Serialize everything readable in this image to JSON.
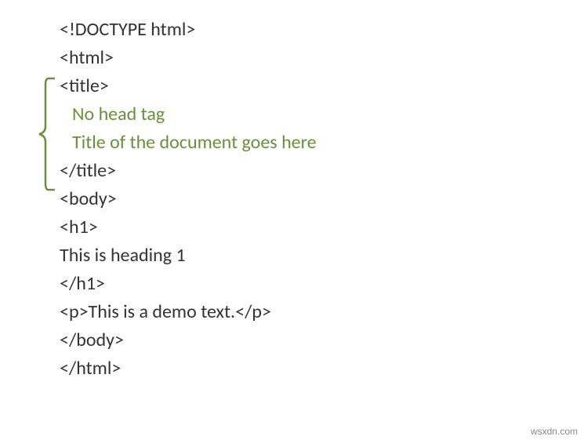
{
  "code": {
    "line1": "<!DOCTYPE html>",
    "line2": "<html>",
    "line3": "<title>",
    "line4": "No head tag",
    "line5": "Title of the document goes here",
    "line6": "</title>",
    "line7": "<body>",
    "line8": "<h1>",
    "line9": "This is heading 1",
    "line10": "</h1>",
    "line11": "<p>This is a demo text.</p>",
    "line12": "</body>",
    "line13": "</html>"
  },
  "watermark": "wsxdn.com",
  "colors": {
    "text": "#333333",
    "annotation": "#6a8f3c"
  }
}
